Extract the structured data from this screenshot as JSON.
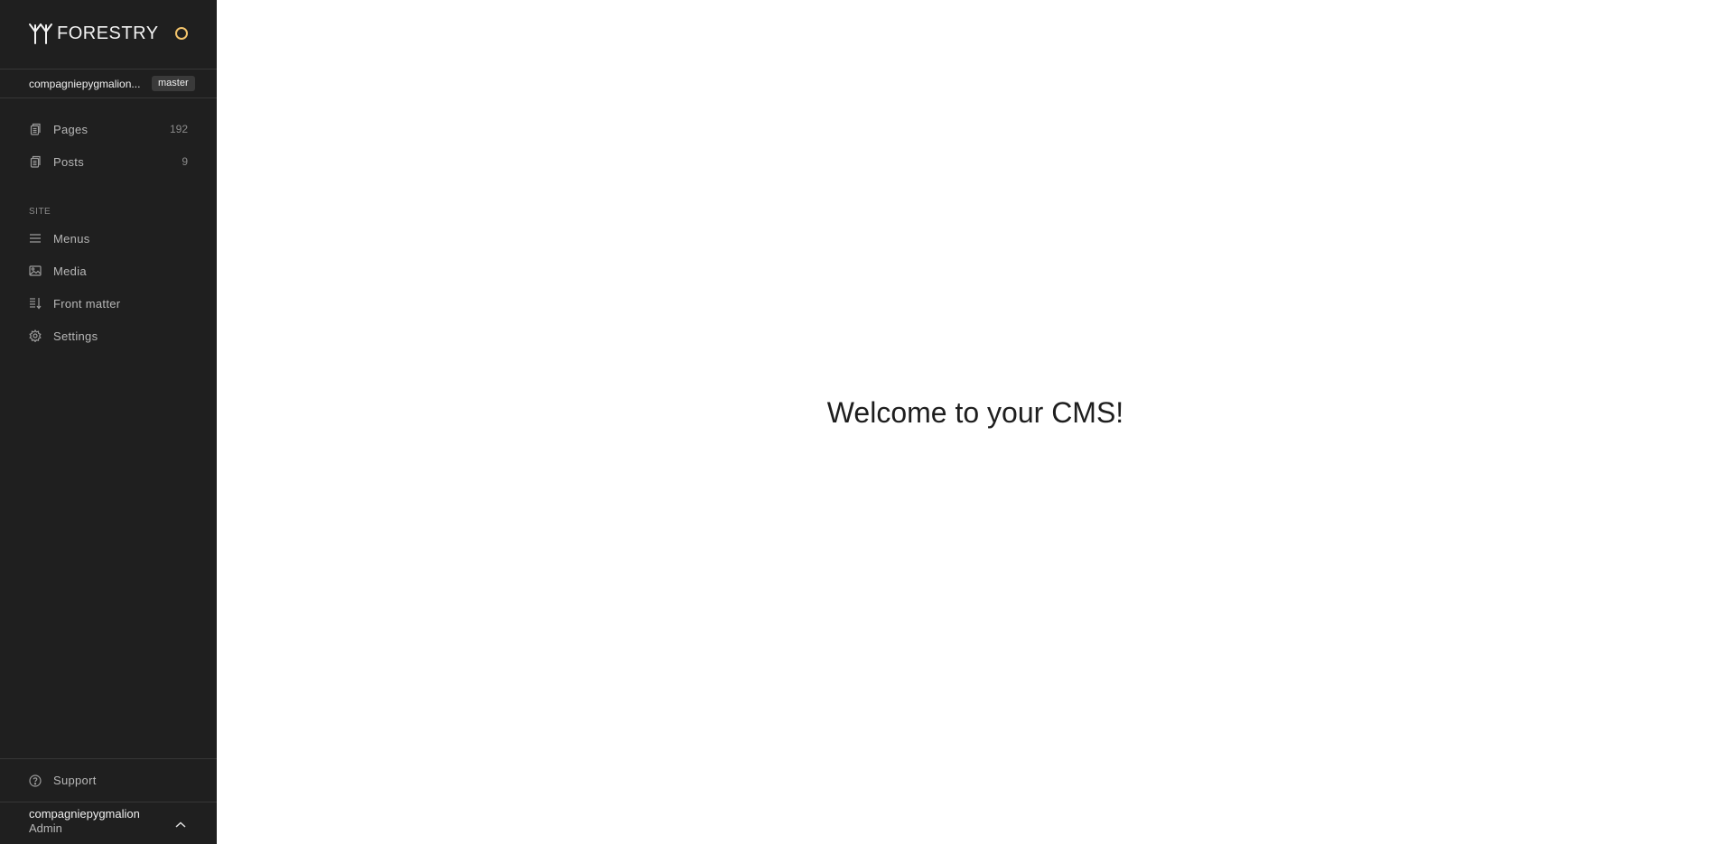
{
  "brand": {
    "name": "FORESTRY",
    "icon": "forestry-logo-icon",
    "status_color": "#f2c36b"
  },
  "repo": {
    "name": "compagniepygmalion...",
    "branch": "master"
  },
  "content_nav": [
    {
      "label": "Pages",
      "count": "192",
      "icon": "document-icon"
    },
    {
      "label": "Posts",
      "count": "9",
      "icon": "document-icon"
    }
  ],
  "site_section": {
    "label": "SITE",
    "items": [
      {
        "label": "Menus",
        "icon": "menu-icon"
      },
      {
        "label": "Media",
        "icon": "image-icon"
      },
      {
        "label": "Front matter",
        "icon": "front-matter-icon"
      },
      {
        "label": "Settings",
        "icon": "gear-icon"
      }
    ]
  },
  "support": {
    "label": "Support",
    "icon": "help-icon"
  },
  "user": {
    "name": "compagniepygmalion",
    "role": "Admin",
    "icon": "chevron-up-icon"
  },
  "main": {
    "welcome": "Welcome to your CMS!"
  },
  "colors": {
    "sidebar_bg": "#1f1f1f",
    "accent": "#f2c36b",
    "main_bg": "#ffffff"
  }
}
